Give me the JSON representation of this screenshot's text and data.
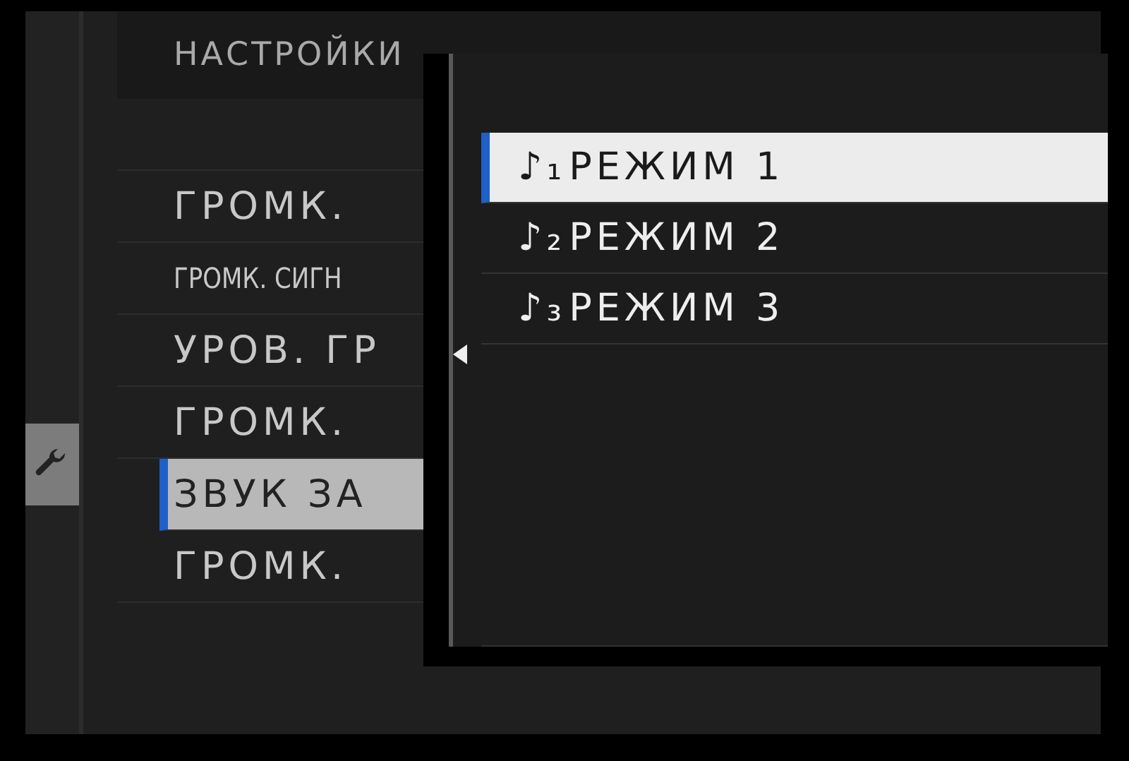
{
  "title": "НАСТРОЙКИ",
  "sidebar": {
    "tabs": [
      {
        "kind": "wrench",
        "selected": true
      }
    ]
  },
  "menu_items": [
    {
      "label": "ГРОМК.",
      "condensed": false,
      "selected": false
    },
    {
      "label": "ГРОМК. СИГН",
      "condensed": true,
      "selected": false
    },
    {
      "label": "УРОВ. ГР",
      "condensed": false,
      "selected": false
    },
    {
      "label": "ГРОМК.",
      "condensed": false,
      "selected": false
    },
    {
      "label": "ЗВУК ЗА",
      "condensed": false,
      "selected": true
    },
    {
      "label": "ГРОМК.",
      "condensed": false,
      "selected": false
    }
  ],
  "popup": {
    "options": [
      {
        "mark": "♪₁",
        "label": "РЕЖИМ 1",
        "selected": true
      },
      {
        "mark": "♪₂",
        "label": "РЕЖИМ 2",
        "selected": false
      },
      {
        "mark": "♪₃",
        "label": "РЕЖИМ 3",
        "selected": false
      }
    ]
  }
}
